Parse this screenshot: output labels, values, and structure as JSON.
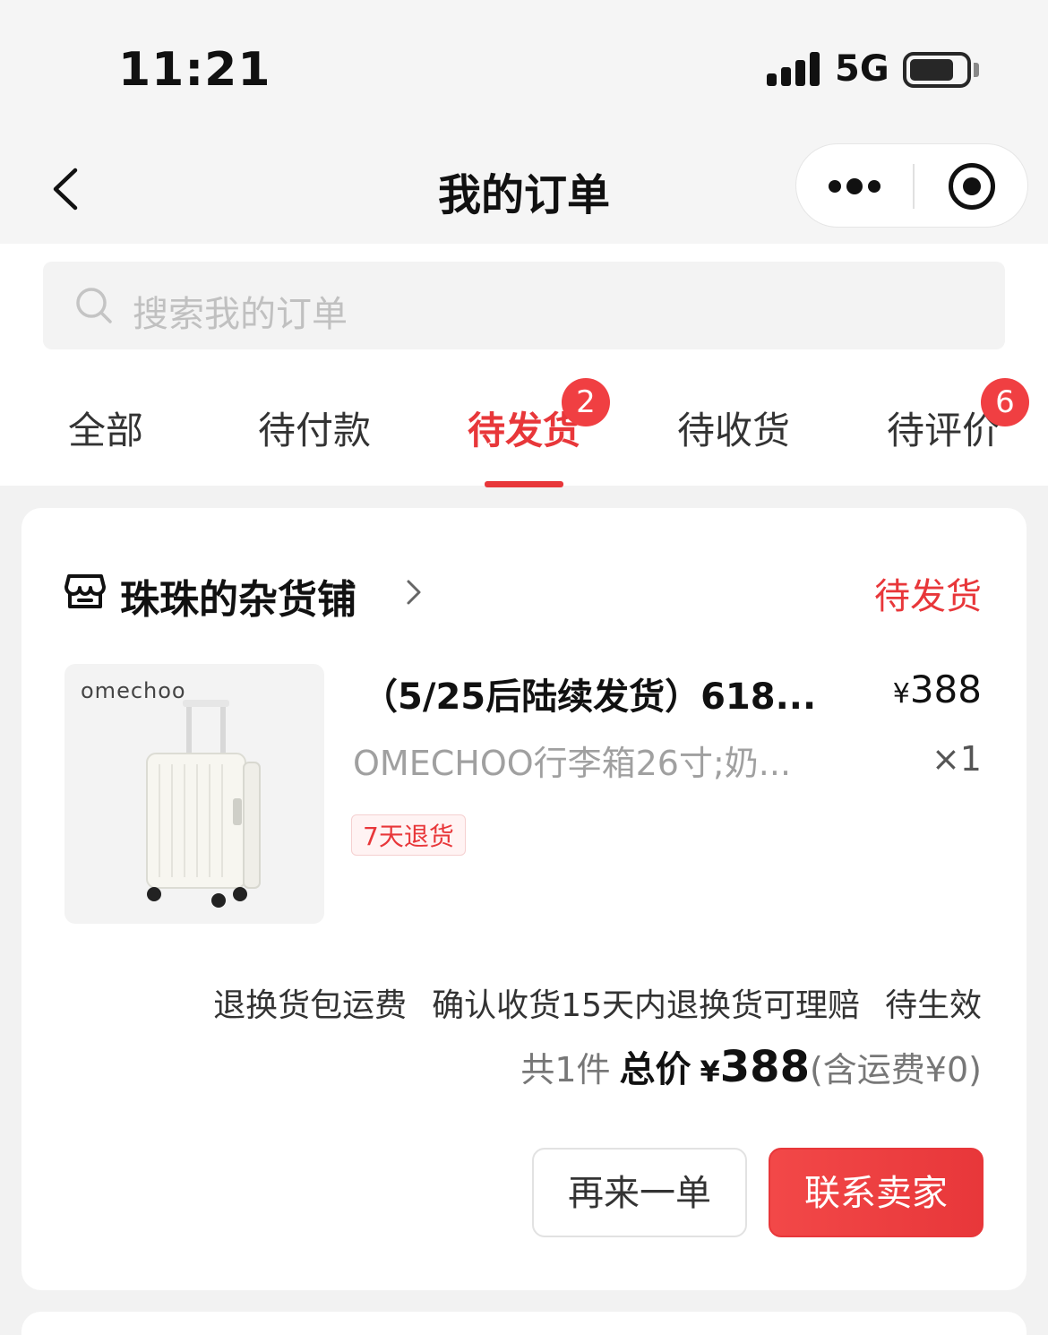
{
  "status_bar": {
    "time": "11:21",
    "network": "5G"
  },
  "nav": {
    "title": "我的订单"
  },
  "search": {
    "placeholder": "搜索我的订单"
  },
  "tabs": [
    {
      "label": "全部",
      "active": false
    },
    {
      "label": "待付款",
      "active": false
    },
    {
      "label": "待发货",
      "active": true,
      "badge": "2"
    },
    {
      "label": "待收货",
      "active": false
    },
    {
      "label": "待评价",
      "active": false,
      "badge": "6"
    }
  ],
  "order": {
    "shop_name": "珠珠的杂货铺",
    "status": "待发货",
    "product": {
      "brand_logo": "omechoo",
      "title": "（5/25后陆续发货）618...",
      "spec": "OMECHOO行李箱26寸;奶...",
      "price_symbol": "¥",
      "price": "388",
      "quantity": "×1",
      "return_tag": "7天退货"
    },
    "services": [
      "退换货包运费",
      "确认收货15天内退换货可理赔",
      "待生效"
    ],
    "summary": {
      "count": "共1件",
      "total_label": "总价",
      "currency": "¥",
      "total": "388",
      "shipping": "(含运费¥0)"
    },
    "buttons": {
      "reorder": "再来一单",
      "contact": "联系卖家"
    }
  },
  "colors": {
    "accent": "#e8373a",
    "badge": "#f03f42"
  },
  "icons": [
    "back-icon",
    "more-icon",
    "close-mini-program-icon",
    "search-icon",
    "shop-icon",
    "chevron-right-icon"
  ]
}
